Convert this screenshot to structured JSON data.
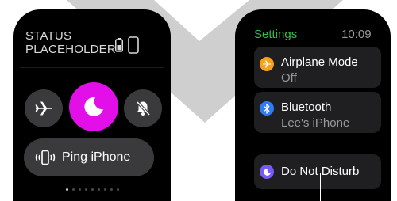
{
  "left_watch": {
    "status_line1": "STATUS",
    "status_line2": "PLACEHOLDER",
    "status_icons": [
      "battery-icon",
      "phone-connection-icon"
    ],
    "controls": [
      {
        "name": "airplane-mode-toggle",
        "icon": "airplane-icon",
        "active": false
      },
      {
        "name": "do-not-disturb-toggle",
        "icon": "moon-icon",
        "active": true,
        "color": "#e20fe8"
      },
      {
        "name": "silent-mode-toggle",
        "icon": "bell-slash-icon",
        "active": false
      }
    ],
    "ping_button_label": "Ping iPhone",
    "page_dots": {
      "count": 9,
      "active_index": 0
    }
  },
  "right_watch": {
    "title": "Settings",
    "time": "10:09",
    "rows": [
      {
        "icon": "airplane-icon",
        "label": "Airplane Mode",
        "value": "Off",
        "icon_color": "#f5a21a"
      },
      {
        "icon": "bluetooth-icon",
        "label": "Bluetooth",
        "value": "Lee's iPhone",
        "icon_color": "#2f7bf6"
      },
      {
        "icon": "moon-icon",
        "label": "Do Not Disturb",
        "value": "",
        "icon_color": "#7a5af5"
      }
    ]
  },
  "colors": {
    "settings_accent": "#2ec24a",
    "dnd_active": "#e20fe8",
    "button_gray": "#3a3a3c"
  }
}
